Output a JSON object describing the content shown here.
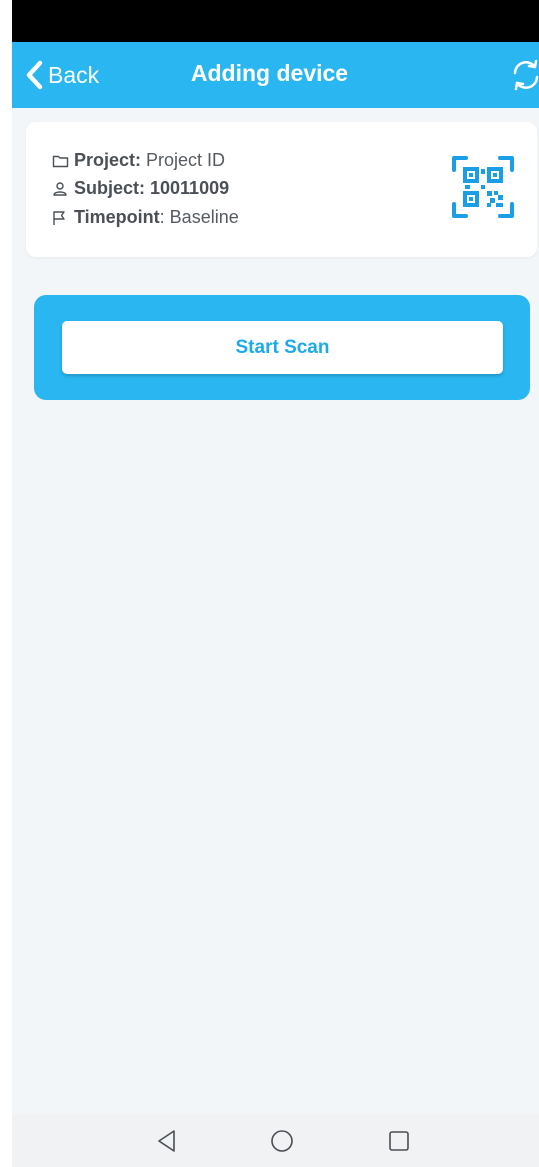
{
  "header": {
    "back_label": "Back",
    "title": "Adding device",
    "refresh_icon": "refresh-icon",
    "color": "#29b6f1"
  },
  "info_card": {
    "project_key": "Project:",
    "project_value": "Project ID",
    "subject_key": "Subject: 10011009",
    "timepoint_key": "Timepoint",
    "timepoint_value": ": Baseline",
    "qr_icon": "qr-code-icon"
  },
  "scan": {
    "start_label": "Start Scan",
    "accent": "#1ea9ea"
  },
  "nav": {
    "back_icon": "triangle-back-icon",
    "home_icon": "circle-home-icon",
    "recent_icon": "square-recents-icon"
  }
}
